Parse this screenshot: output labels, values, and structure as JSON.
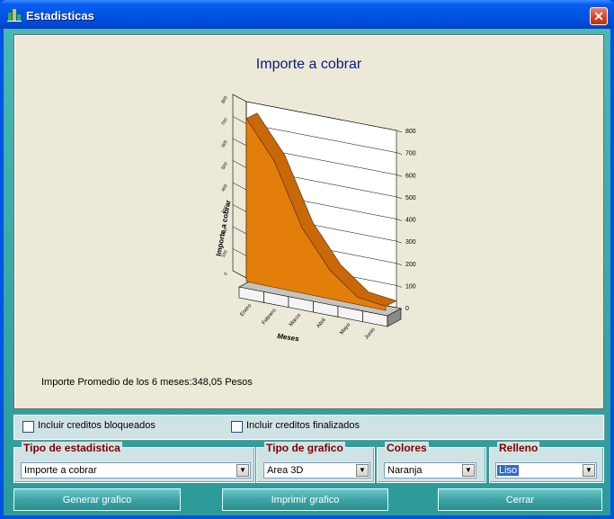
{
  "window": {
    "title": "Estadisticas",
    "close_glyph": "✕"
  },
  "chart_panel": {
    "avg_text": "Importe Promedio de los 6 meses:348,05 Pesos"
  },
  "chart_data": {
    "type": "area",
    "title": "Importe a cobrar",
    "xlabel": "Meses",
    "ylabel": "Importe a cobrar",
    "y_right_ticks": [
      "800",
      "700",
      "600",
      "500",
      "400",
      "300",
      "200",
      "100",
      "0"
    ],
    "y_left_ticks": [
      "800",
      "700",
      "600",
      "500",
      "400",
      "300",
      "200",
      "100",
      "0"
    ],
    "categories": [
      "Enero",
      "Febrero",
      "Marzo",
      "Abril",
      "Mayo",
      "Junio"
    ],
    "values": [
      800,
      620,
      320,
      140,
      35,
      20
    ],
    "ylim": [
      0,
      800
    ],
    "series_color": "#e37e0a"
  },
  "checkboxes": [
    {
      "label": "Incluir creditos bloqueados",
      "checked": false
    },
    {
      "label": "Incluir creditos finalizados",
      "checked": false
    }
  ],
  "groups": {
    "tipo_estadistica": {
      "title": "Tipo de estadistica",
      "value": "Importe a cobrar"
    },
    "tipo_grafico": {
      "title": "Tipo de grafico",
      "value": "Area 3D"
    },
    "colores": {
      "title": "Colores",
      "value": "Naranja"
    },
    "relleno": {
      "title": "Relleno",
      "value": "Liso"
    }
  },
  "buttons": {
    "generar": "Generar grafico",
    "imprimir": "Imprimir grafico",
    "cerrar": "Cerrar"
  }
}
